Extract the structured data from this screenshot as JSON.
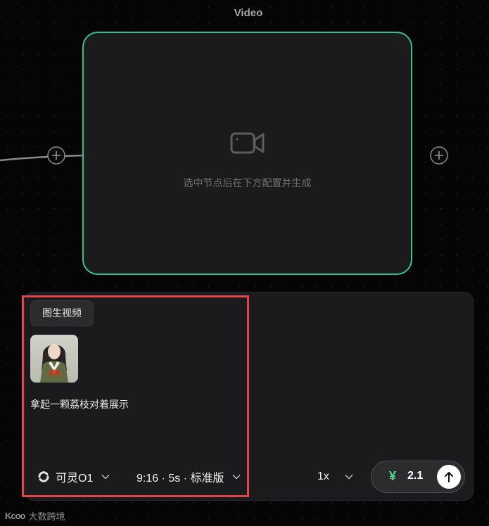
{
  "node": {
    "title": "Video",
    "placeholder": "选中节点后在下方配置并生成",
    "icon": "video-camera-icon",
    "border_color": "#2ec48d"
  },
  "panel": {
    "mode_tag": "图生视频",
    "prompt": "拿起一颗荔枝对着展示",
    "model": {
      "label": "可灵O1",
      "icon": "kling-logo-icon"
    },
    "spec": "9:16 · 5s · 标准版",
    "speed": "1x",
    "cost": {
      "symbol": "¥",
      "value": "2.1"
    },
    "highlight_color": "#e0464c"
  },
  "watermark": {
    "logo": "Kcoo",
    "text": "大数跨境"
  }
}
